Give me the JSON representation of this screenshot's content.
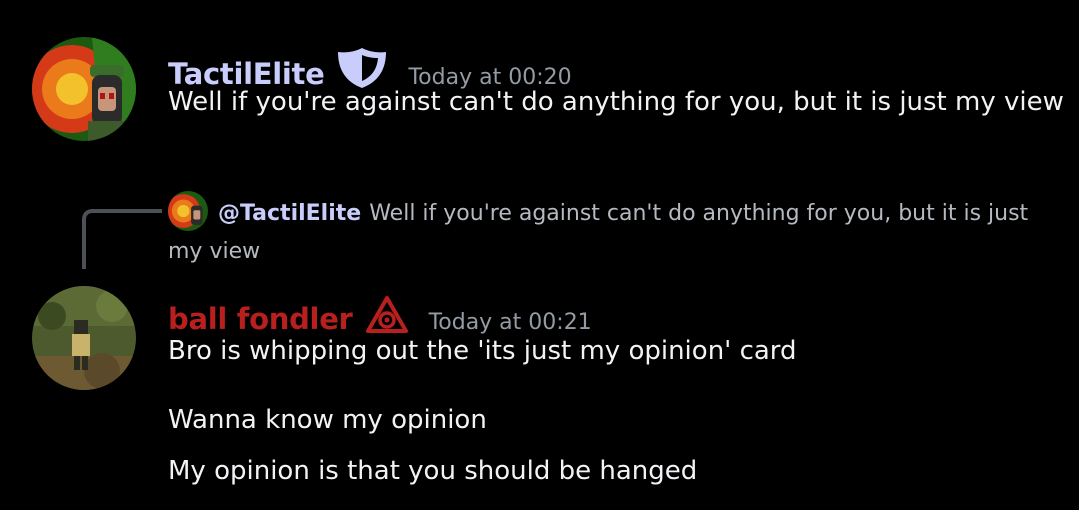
{
  "messages": [
    {
      "username": "TactilElite",
      "username_color": "#c9cdfb",
      "badge_icon": "shield-icon",
      "timestamp": "Today at 00:20",
      "lines": [
        "Well if you're against can't do anything for you, but it is just my view"
      ]
    },
    {
      "reply": {
        "mention": "@TactilElite",
        "text": "Well if you're against can't do anything for you, but it is just my view"
      },
      "username": "ball fondler",
      "username_color": "#b8201e",
      "badge_icon": "triangle-emblem-icon",
      "timestamp": "Today at 00:21",
      "lines": [
        "Bro is whipping out the 'its just my opinion' card",
        "Wanna know my opinion",
        "My opinion is that you should be hanged"
      ]
    }
  ]
}
